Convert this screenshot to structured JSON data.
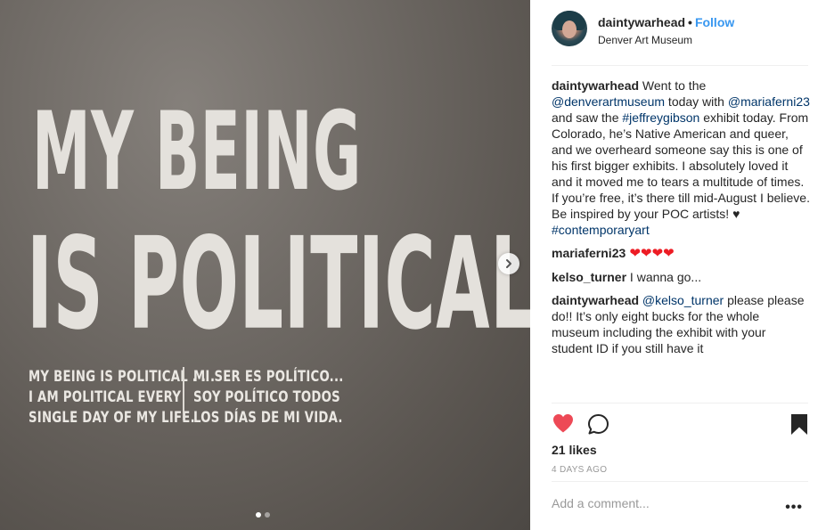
{
  "photo": {
    "headline_line1": "MY BEING",
    "headline_line2": "IS POLITICAL",
    "english_lines": [
      "MY BEING IS POLITICAL . . .",
      "I AM POLITICAL EVERY",
      "SINGLE DAY OF MY LIFE."
    ],
    "spanish_lines": [
      "MI SER ES POLÍTICO...",
      "SOY POLÍTICO TODOS",
      "LOS DÍAS DE MI VIDA."
    ],
    "carousel_dots": 2,
    "active_dot": 0
  },
  "post": {
    "username": "daintywarhead",
    "separator": "•",
    "follow_label": "Follow",
    "location": "Denver Art Museum"
  },
  "caption": {
    "username": "daintywarhead",
    "text_1": " Went to the ",
    "mention_1": "@denverartmuseum",
    "text_2": " today with ",
    "mention_2": "@mariaferni23",
    "text_3": " and saw the ",
    "hashtag_1": "#jeffreygibson",
    "text_4": " exhibit today. From Colorado, he’s Native American and queer, and we overheard someone say this is one of his first bigger exhibits. I absolutely loved it and it moved me to tears a multitude of times. If you’re free, it’s there till mid-August I believe. Be inspired by your POC artists! ♥ ",
    "hashtag_2": "#contemporaryart"
  },
  "comments": [
    {
      "username": "mariaferni23",
      "text": " ❤❤❤❤"
    },
    {
      "username": "kelso_turner",
      "text": " I wanna go..."
    },
    {
      "username": "daintywarhead",
      "mention": "@kelso_turner",
      "text": " please please do!! It’s only eight bucks for the whole museum including the exhibit with your student ID if you still have it"
    }
  ],
  "stats": {
    "likes": "21 likes",
    "time": "4 DAYS AGO"
  },
  "comment_box": {
    "placeholder": "Add a comment...",
    "more_label": "•••"
  },
  "colors": {
    "like_red": "#ed4956",
    "link_blue": "#003569",
    "follow_blue": "#3897f0"
  },
  "icons": {
    "next": "chevron-right-icon",
    "like": "heart-filled-icon",
    "comment": "speech-bubble-icon",
    "save": "bookmark-filled-icon",
    "more": "more-dots-icon"
  }
}
